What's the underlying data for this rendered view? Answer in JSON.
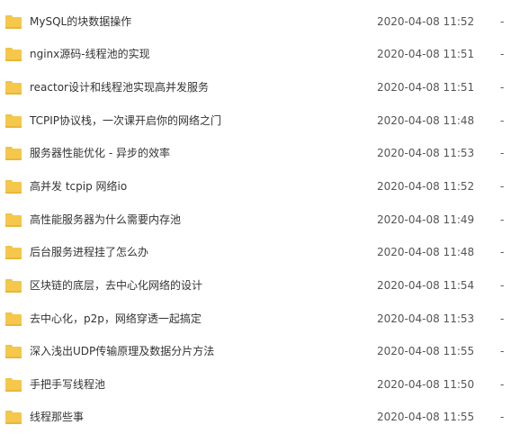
{
  "files": [
    {
      "name": "MySQL的块数据操作",
      "date": "2020-04-08 11:52",
      "size": "-"
    },
    {
      "name": "nginx源码-线程池的实现",
      "date": "2020-04-08 11:51",
      "size": "-"
    },
    {
      "name": "reactor设计和线程池实现高并发服务",
      "date": "2020-04-08 11:51",
      "size": "-"
    },
    {
      "name": "TCPIP协议栈，一次课开启你的网络之门",
      "date": "2020-04-08 11:48",
      "size": "-"
    },
    {
      "name": "服务器性能优化 - 异步的效率",
      "date": "2020-04-08 11:53",
      "size": "-"
    },
    {
      "name": "高并发 tcpip 网络io",
      "date": "2020-04-08 11:52",
      "size": "-"
    },
    {
      "name": "高性能服务器为什么需要内存池",
      "date": "2020-04-08 11:49",
      "size": "-"
    },
    {
      "name": "后台服务进程挂了怎么办",
      "date": "2020-04-08 11:48",
      "size": "-"
    },
    {
      "name": "区块链的底层，去中心化网络的设计",
      "date": "2020-04-08 11:54",
      "size": "-"
    },
    {
      "name": "去中心化，p2p，网络穿透一起搞定",
      "date": "2020-04-08 11:53",
      "size": "-"
    },
    {
      "name": "深入浅出UDP传输原理及数据分片方法",
      "date": "2020-04-08 11:55",
      "size": "-"
    },
    {
      "name": "手把手写线程池",
      "date": "2020-04-08 11:50",
      "size": "-"
    },
    {
      "name": "线程那些事",
      "date": "2020-04-08 11:55",
      "size": "-"
    }
  ],
  "icon": {
    "name": "folder-icon",
    "color": "#f5c84c"
  }
}
